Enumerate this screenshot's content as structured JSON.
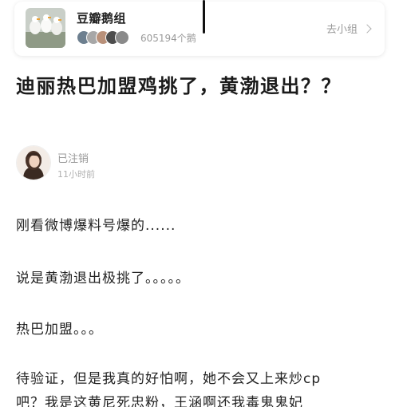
{
  "group": {
    "name": "豆瓣鹅组",
    "member_count": "605194个鹅",
    "enter_label": "去小组"
  },
  "post": {
    "title": "迪丽热巴加盟鸡挑了，黄渤退出？？",
    "author": "已注销",
    "time": "11小时前",
    "paragraphs": [
      "刚看微博爆料号爆的......",
      "说是黄渤退出极挑了。。。。。",
      "热巴加盟。。。",
      "待验证，但是我真的好怕啊，她不会又上来炒cp",
      "吧？我是这黄尼死忠粉，王涵啊还我毒鬼鬼妃"
    ]
  },
  "colors": {
    "title_text": "#1a1a1a",
    "muted_text": "#9a9a9a",
    "card_shadow": "rgba(0,0,0,0.10)"
  }
}
